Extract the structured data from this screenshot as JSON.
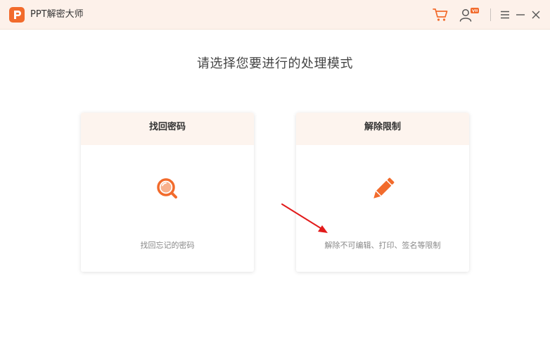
{
  "app": {
    "title": "PPT解密大师",
    "accent_color": "#f26b2c"
  },
  "titlebar": {
    "cart_icon": "cart-icon",
    "user_icon": "user-vip-icon",
    "menu_icon": "hamburger-menu-icon",
    "minimize_icon": "minimize-icon",
    "close_icon": "close-icon"
  },
  "main": {
    "heading": "请选择您要进行的处理模式",
    "cards": [
      {
        "title": "找回密码",
        "icon": "magnifier-icon",
        "description": "找回忘记的密码"
      },
      {
        "title": "解除限制",
        "icon": "pencil-icon",
        "description": "解除不可编辑、打印、签名等限制"
      }
    ]
  }
}
